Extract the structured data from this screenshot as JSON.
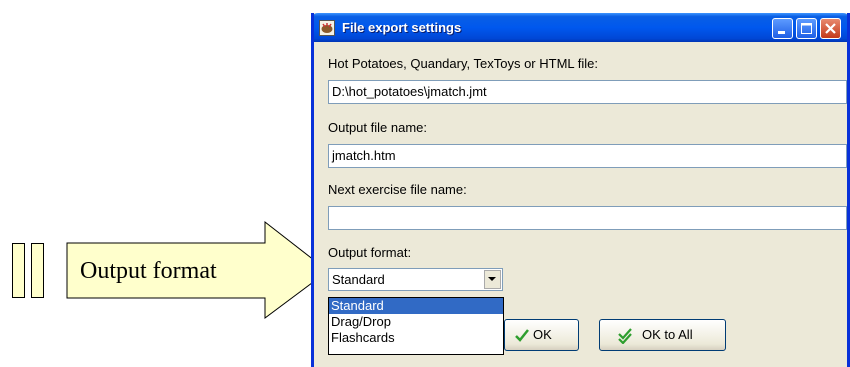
{
  "callout": {
    "text": "Output format",
    "fill": "#ffffcc"
  },
  "window": {
    "title": "File export settings",
    "icons": {
      "app": "hot-potatoes-icon",
      "minimize": "minimize-icon",
      "maximize": "maximize-icon",
      "close": "close-icon"
    }
  },
  "form": {
    "source_label": "Hot Potatoes, Quandary, TexToys or HTML file:",
    "source_value": "D:\\hot_potatoes\\jmatch.jmt",
    "output_label": "Output file name:",
    "output_value": "jmatch.htm",
    "next_label": "Next exercise file name:",
    "next_value": "",
    "format_label": "Output format:",
    "format_value": "Standard",
    "format_options": [
      "Standard",
      "Drag/Drop",
      "Flashcards"
    ],
    "format_selected_index": 0
  },
  "buttons": {
    "ok": "OK",
    "ok_all": "OK to All"
  },
  "colors": {
    "title_bar": "#0058ee",
    "selection": "#316ac5",
    "check_green": "#2e9e2e"
  }
}
